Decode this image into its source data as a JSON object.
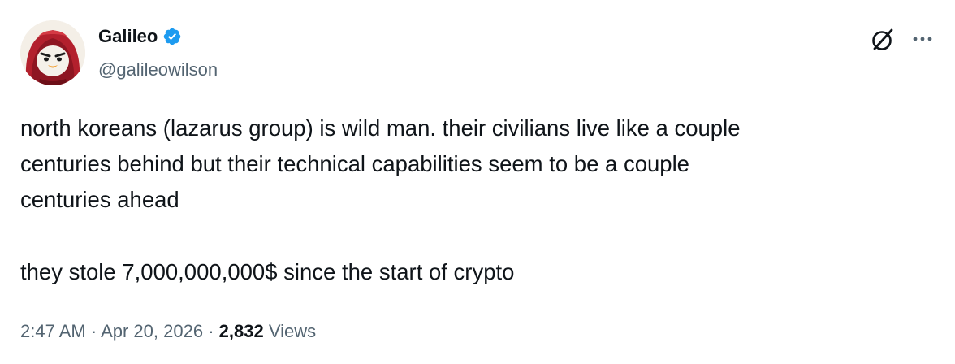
{
  "author": {
    "display_name": "Galileo",
    "handle": "@galileowilson",
    "verified": true,
    "verified_color": "#1d9bf0",
    "avatar_icon": "hooded-penguin-avatar"
  },
  "actions": {
    "grok_icon": "grok-icon",
    "more_icon": "more-horizontal-icon"
  },
  "body": {
    "paragraph_1_lines": [
      "north koreans (lazarus group) is wild man. their civilians live like a couple",
      "centuries behind but their technical capabilities seem to be a couple",
      "centuries ahead"
    ],
    "paragraph_2": "they stole 7,000,000,000$ since the start of crypto"
  },
  "meta": {
    "time": "2:47 AM",
    "separator": "·",
    "date": "Apr 20, 2026",
    "views_count": "2,832",
    "views_label": "Views"
  }
}
